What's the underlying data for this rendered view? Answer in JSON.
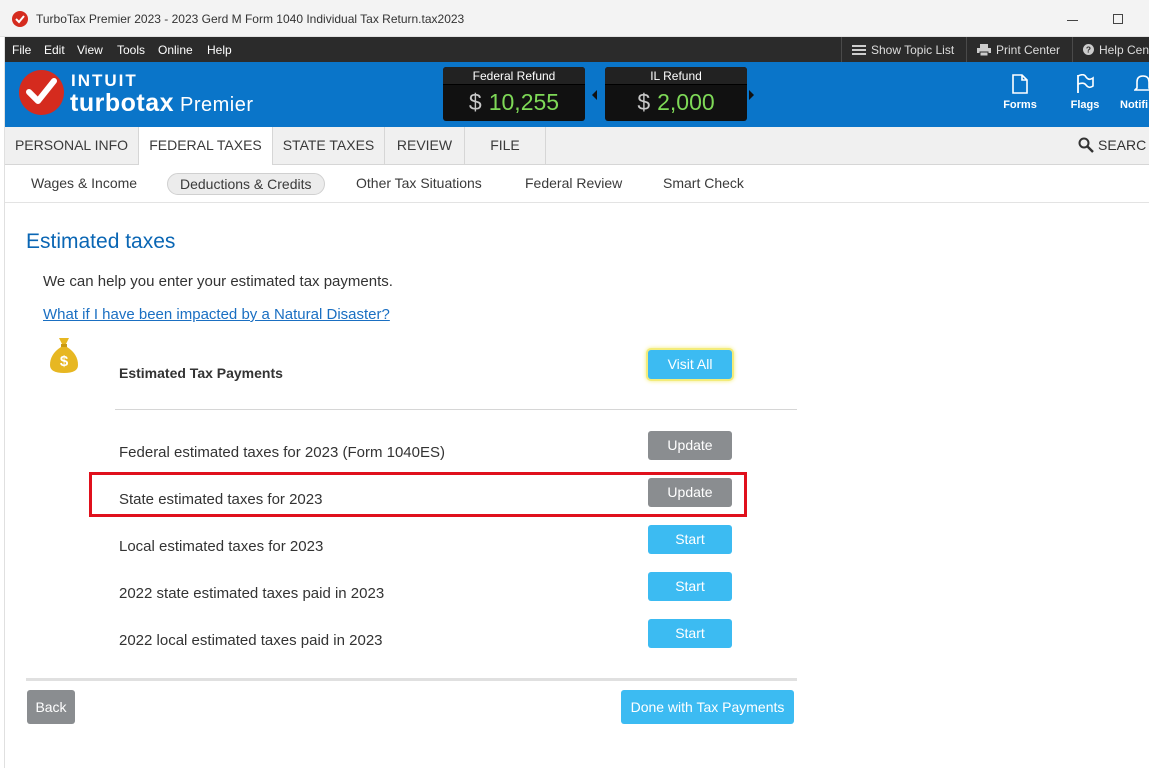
{
  "window": {
    "title": "TurboTax Premier 2023 - 2023 Gerd M Form 1040  Individual Tax Return.tax2023"
  },
  "menu": {
    "items": [
      "File",
      "Edit",
      "View",
      "Tools",
      "Online",
      "Help"
    ],
    "right": {
      "topic_list": "Show Topic List",
      "print_center": "Print Center",
      "help_center": "Help Cen"
    }
  },
  "header": {
    "brand_intuit": "INTUIT",
    "brand_turbotax": "turbotax",
    "brand_edition": "Premier",
    "federal_refund": {
      "label": "Federal Refund",
      "currency": "$",
      "amount": "10,255"
    },
    "state_refund": {
      "label": "IL Refund",
      "currency": "$",
      "amount": "2,000"
    },
    "buttons": {
      "forms": "Forms",
      "flags": "Flags",
      "notifications": "Notifi"
    }
  },
  "tabs": [
    "PERSONAL INFO",
    "FEDERAL TAXES",
    "STATE TAXES",
    "REVIEW",
    "FILE"
  ],
  "active_tab": "FEDERAL TAXES",
  "search_label": "SEARC",
  "subtabs": [
    "Wages & Income",
    "Deductions & Credits",
    "Other Tax Situations",
    "Federal Review",
    "Smart Check"
  ],
  "active_subtab": "Deductions & Credits",
  "content": {
    "title": "Estimated taxes",
    "intro": "We can help you enter your estimated tax payments.",
    "disaster_link": "What if I have been impacted by a Natural Disaster?",
    "section_title": "Estimated Tax Payments",
    "visit_all": "Visit All",
    "rows": [
      {
        "label": "Federal estimated taxes for 2023 (Form 1040ES)",
        "action": "Update"
      },
      {
        "label": "State estimated taxes for 2023",
        "action": "Update"
      },
      {
        "label": "Local estimated taxes for 2023",
        "action": "Start"
      },
      {
        "label": "2022 state estimated taxes paid in 2023",
        "action": "Start"
      },
      {
        "label": "2022 local estimated taxes paid in 2023",
        "action": "Start"
      }
    ],
    "back": "Back",
    "done": "Done with Tax Payments"
  },
  "colors": {
    "header_blue": "#0a75c9",
    "title_blue": "#0a66b4",
    "button_blue": "#3cbbf2",
    "button_gray": "#8a8d90",
    "refund_green": "#7ed957",
    "highlight_red": "#e0101c",
    "brand_red": "#d52b1e"
  }
}
